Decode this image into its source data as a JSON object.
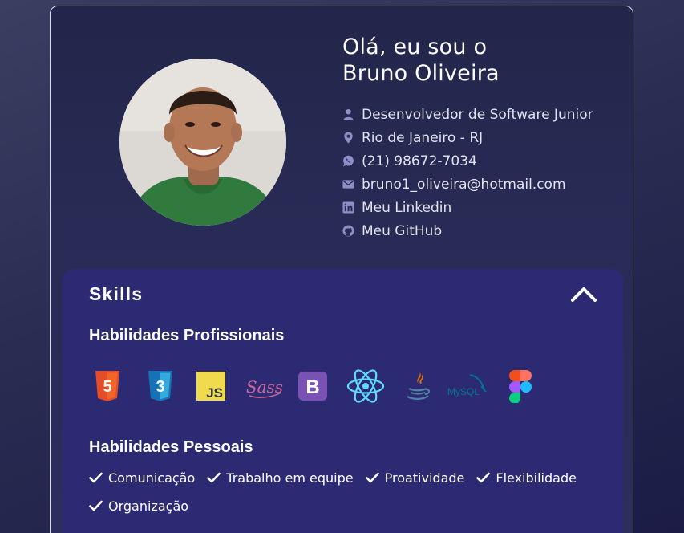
{
  "profile": {
    "greeting_line1": "Olá, eu sou o",
    "greeting_line2": "Bruno Oliveira",
    "avatar_icon": "profile-photo",
    "info": [
      {
        "icon": "user-icon",
        "text": "Desenvolvedor de Software Junior"
      },
      {
        "icon": "map-pin-icon",
        "text": "Rio de Janeiro - RJ"
      },
      {
        "icon": "whatsapp-icon",
        "text": "(21) 98672-7034"
      },
      {
        "icon": "mail-icon",
        "text": "bruno1_oliveira@hotmail.com"
      },
      {
        "icon": "linkedin-icon",
        "text": "Meu Linkedin"
      },
      {
        "icon": "github-icon",
        "text": "Meu GitHub"
      }
    ]
  },
  "skills": {
    "title": "Skills",
    "toggle_icon": "chevron-up-icon",
    "professional_title": "Habilidades Profissionais",
    "tech": [
      {
        "icon": "html5-icon",
        "label": "5"
      },
      {
        "icon": "css3-icon",
        "label": "3"
      },
      {
        "icon": "javascript-icon",
        "label": "JS"
      },
      {
        "icon": "sass-icon",
        "label": "Sass"
      },
      {
        "icon": "bootstrap-icon",
        "label": "B"
      },
      {
        "icon": "react-icon"
      },
      {
        "icon": "java-icon"
      },
      {
        "icon": "mysql-icon",
        "label": "MySQL"
      },
      {
        "icon": "figma-icon"
      }
    ],
    "personal_title": "Habilidades Pessoais",
    "personal": [
      "Comunicação",
      "Trabalho em equipe",
      "Proatividade",
      "Flexibilidade",
      "Organização"
    ]
  },
  "colors": {
    "skills_panel": "#2c2a72",
    "icon_muted": "#8f8fc8",
    "accent_text": "#ffffff"
  }
}
